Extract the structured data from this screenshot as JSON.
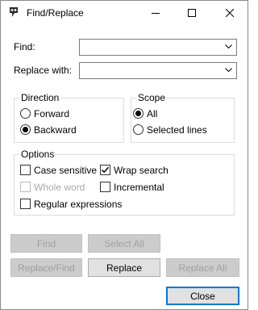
{
  "window": {
    "title": "Find/Replace",
    "icon": "app-logo-icon",
    "controls": {
      "minimize": "minimize-icon",
      "maximize": "maximize-icon",
      "close": "close-icon"
    }
  },
  "find": {
    "label": "Find:",
    "value": ""
  },
  "replace": {
    "label": "Replace with:",
    "value": ""
  },
  "direction": {
    "label": "Direction",
    "options": [
      {
        "label": "Forward",
        "checked": false
      },
      {
        "label": "Backward",
        "checked": true
      }
    ]
  },
  "scope": {
    "label": "Scope",
    "options": [
      {
        "label": "All",
        "checked": true
      },
      {
        "label": "Selected lines",
        "checked": false
      }
    ]
  },
  "options": {
    "label": "Options",
    "case_sensitive": {
      "label": "Case sensitive",
      "checked": false,
      "enabled": true
    },
    "wrap_search": {
      "label": "Wrap search",
      "checked": true,
      "enabled": true
    },
    "whole_word": {
      "label": "Whole word",
      "checked": false,
      "enabled": false
    },
    "incremental": {
      "label": "Incremental",
      "checked": false,
      "enabled": true
    },
    "regex": {
      "label": "Regular expressions",
      "checked": false,
      "enabled": true
    }
  },
  "buttons": {
    "find": "Find",
    "select_all": "Select All",
    "replace_find": "Replace/Find",
    "replace": "Replace",
    "replace_all": "Replace All",
    "close": "Close"
  },
  "colors": {
    "accent": "#0078d7"
  }
}
